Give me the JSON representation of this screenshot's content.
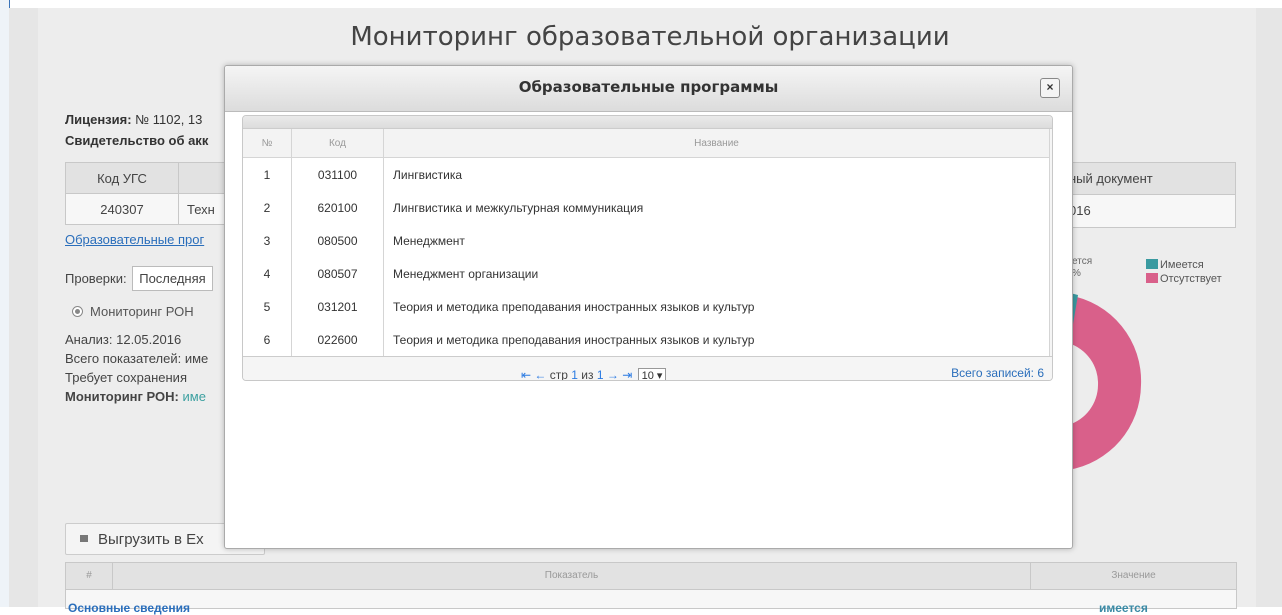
{
  "page": {
    "title": "Мониторинг образовательной организации",
    "license_label": "Лицензия:",
    "license_value": "№ 1102, 13",
    "certificate_label": "Свидетельство об акк",
    "programs_link": "Образовательные прог",
    "checks_label": "Проверки:",
    "checks_value": "Последняя",
    "radio_label": "Мониторинг РОН",
    "analysis": "Анализ: 12.05.2016",
    "indicators": "Всего показателей: име",
    "requires_save": "Требует сохранения",
    "monitoring_label": "Мониторинг РОН:",
    "monitoring_value": "име",
    "export_button": "Выгрузить в Ex"
  },
  "ugs_table": {
    "headers": [
      "Код УГС",
      ""
    ],
    "row": [
      "240307",
      "Техн"
    ],
    "doc_header": "ный документ",
    "doc_value": "016"
  },
  "chart": {
    "pct_label_1": "ется",
    "pct_label_2": "%",
    "legend": [
      {
        "label": "Имеется",
        "color": "#3a9aa0"
      },
      {
        "label": "Отсутствует",
        "color": "#d9608a"
      }
    ]
  },
  "bottom_table": {
    "headers": [
      "#",
      "Показатель",
      "Значение"
    ],
    "row_label": "Основные сведения",
    "row_value": "имеется"
  },
  "modal": {
    "title": "Образовательные программы",
    "close_icon": "×",
    "columns": [
      "№",
      "Код",
      "Название"
    ],
    "rows": [
      {
        "n": "1",
        "code": "031100",
        "name": "Лингвистика"
      },
      {
        "n": "2",
        "code": "620100",
        "name": "Лингвистика и межкультурная коммуникация"
      },
      {
        "n": "3",
        "code": "080500",
        "name": "Менеджмент"
      },
      {
        "n": "4",
        "code": "080507",
        "name": "Менеджмент организации"
      },
      {
        "n": "5",
        "code": "031201",
        "name": "Теория и методика преподавания иностранных языков и культур"
      },
      {
        "n": "6",
        "code": "022600",
        "name": "Теория и методика преподавания иностранных языков и культур"
      }
    ],
    "pager": {
      "first": "⇤",
      "prev": "←",
      "page_prefix": "стр",
      "page_current": "1",
      "page_of": "из",
      "page_total": "1",
      "next": "→",
      "last": "⇥",
      "page_size": "10 ▾",
      "total": "Всего записей: 6"
    }
  }
}
